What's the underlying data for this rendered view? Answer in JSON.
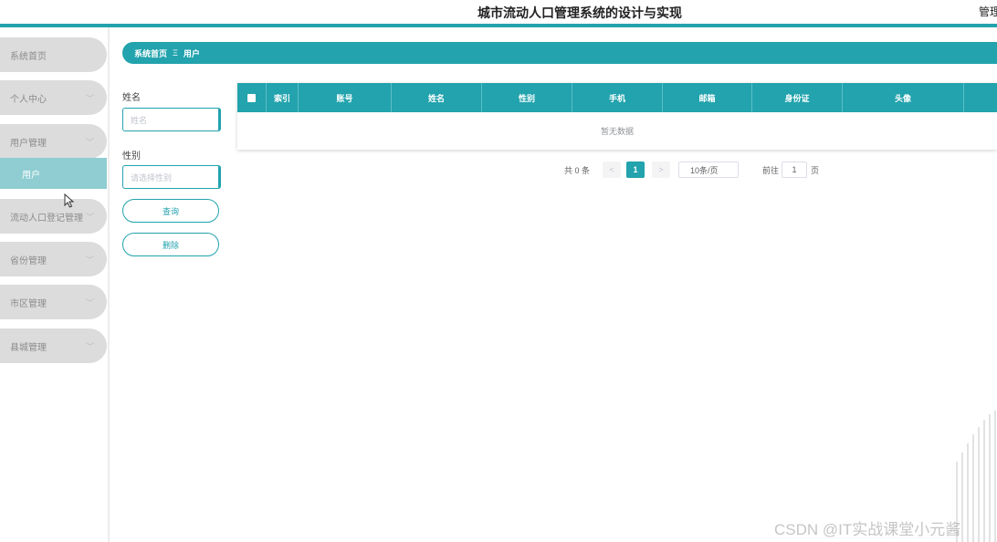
{
  "header": {
    "title": "城市流动人口管理系统的设计与实现",
    "admin": "管理"
  },
  "sidebar": {
    "items": [
      {
        "label": "系统首页",
        "has_chevron": false
      },
      {
        "label": "个人中心",
        "has_chevron": true
      },
      {
        "label": "用户管理",
        "has_chevron": true
      },
      {
        "label": "用户",
        "sub": true
      },
      {
        "label": "流动人口登记管理",
        "has_chevron": true
      },
      {
        "label": "省份管理",
        "has_chevron": true
      },
      {
        "label": "市区管理",
        "has_chevron": true
      },
      {
        "label": "县城管理",
        "has_chevron": true
      }
    ]
  },
  "breadcrumb": {
    "home": "系统首页",
    "separator": "Ξ",
    "current": "用户"
  },
  "filters": {
    "name_label": "姓名",
    "name_placeholder": "姓名",
    "gender_label": "性别",
    "gender_placeholder": "请选择性别",
    "query_button": "查询",
    "delete_button": "删除"
  },
  "table": {
    "columns": [
      "索引",
      "账号",
      "姓名",
      "性别",
      "手机",
      "邮箱",
      "身份证",
      "头像"
    ],
    "empty_text": "暂无数据"
  },
  "pagination": {
    "total": "共 0 条",
    "prev": "<",
    "current_page": "1",
    "next": ">",
    "page_size": "10条/页",
    "goto_label": "前往",
    "goto_value": "1",
    "page_suffix": "页"
  },
  "watermark": "CSDN @IT实战课堂小元酱",
  "colors": {
    "accent": "#22a3ad",
    "sub_menu": "#8fcdd2",
    "menu": "#dcdcdc"
  }
}
